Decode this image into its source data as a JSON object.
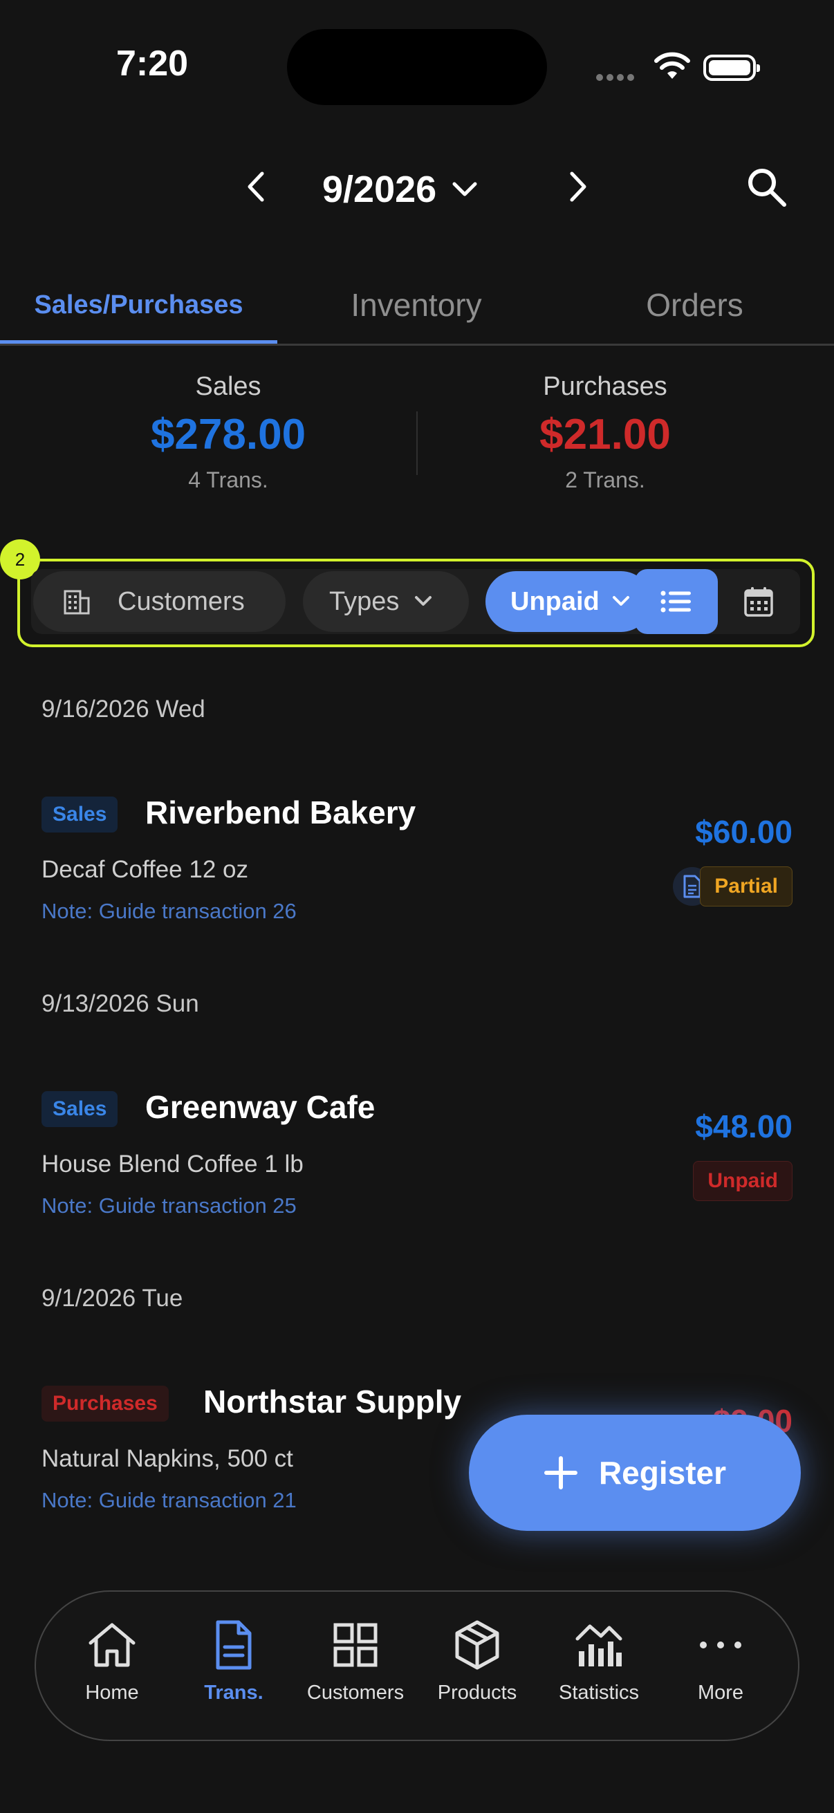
{
  "status_bar": {
    "time": "7:20"
  },
  "header": {
    "month": "9/2026"
  },
  "tabs": [
    {
      "label": "Sales/Purchases",
      "active": true
    },
    {
      "label": "Inventory",
      "active": false
    },
    {
      "label": "Orders",
      "active": false
    }
  ],
  "summary": {
    "sales": {
      "label": "Sales",
      "amount": "$278.00",
      "count": "4 Trans.",
      "color": "#1f73e0"
    },
    "purchases": {
      "label": "Purchases",
      "amount": "$21.00",
      "count": "2 Trans.",
      "color": "#cf2a2a"
    }
  },
  "filters": {
    "annotation_badge": "2",
    "customers": "Customers",
    "types": "Types",
    "status": "Unpaid"
  },
  "transactions": [
    {
      "date": "9/16/2026 Wed",
      "type": "Sales",
      "party": "Riverbend Bakery",
      "item": "Decaf Coffee 12 oz",
      "note": "Note: Guide transaction 26",
      "amount": "$60.00",
      "status": "Partial"
    },
    {
      "date": "9/13/2026 Sun",
      "type": "Sales",
      "party": "Greenway Cafe",
      "item": "House Blend Coffee 1 lb",
      "note": "Note: Guide transaction 25",
      "amount": "$48.00",
      "status": "Unpaid"
    },
    {
      "date": "9/1/2026 Tue",
      "type": "Purchases",
      "party": "Northstar Supply",
      "item": "Natural Napkins, 500 ct",
      "note": "Note: Guide transaction 21",
      "amount": "$9.00"
    }
  ],
  "fab": {
    "label": "Register"
  },
  "bottom_nav": [
    {
      "label": "Home",
      "icon": "home-icon"
    },
    {
      "label": "Trans.",
      "icon": "document-icon",
      "active": true
    },
    {
      "label": "Customers",
      "icon": "grid-icon"
    },
    {
      "label": "Products",
      "icon": "box-icon"
    },
    {
      "label": "Statistics",
      "icon": "chart-icon"
    },
    {
      "label": "More",
      "icon": "more-icon"
    }
  ],
  "colors": {
    "accent": "#5b8ef0",
    "highlight": "#d2f22c",
    "background": "#141414"
  }
}
